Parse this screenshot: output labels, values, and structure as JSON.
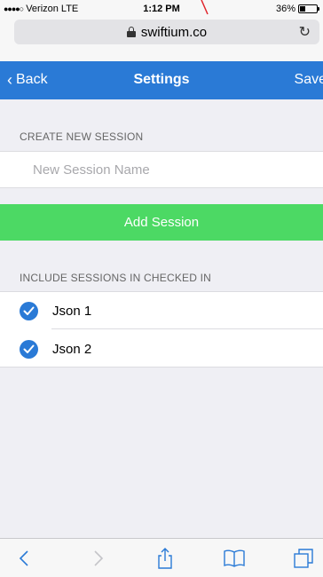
{
  "status_bar": {
    "carrier": "Verizon",
    "network": "LTE",
    "time": "1:12 PM",
    "battery": "36%",
    "battery_level": 0.36
  },
  "browser": {
    "url": "swiftium.co"
  },
  "navbar": {
    "back_label": "Back",
    "title": "Settings",
    "save_label": "Save",
    "color": "#2a7ad6"
  },
  "create_section": {
    "header": "CREATE NEW SESSION",
    "input_placeholder": "New Session Name",
    "input_value": "",
    "add_button_label": "Add Session",
    "add_button_color": "#4cd964"
  },
  "include_section": {
    "header": "INCLUDE SESSIONS IN CHECKED IN",
    "items": [
      {
        "label": "Json 1",
        "checked": true
      },
      {
        "label": "Json 2",
        "checked": true
      }
    ]
  },
  "toolbar": {
    "icons": [
      "back-icon",
      "forward-icon",
      "share-icon",
      "bookmarks-icon",
      "tabs-icon"
    ]
  }
}
